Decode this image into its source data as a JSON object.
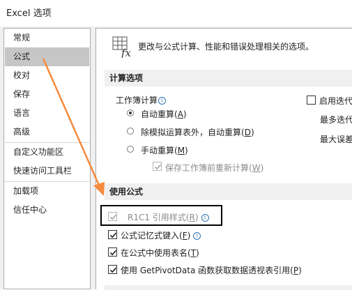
{
  "window": {
    "title": "Excel 选项"
  },
  "sidebar": {
    "items": [
      {
        "label": "常规"
      },
      {
        "label": "公式"
      },
      {
        "label": "校对"
      },
      {
        "label": "保存"
      },
      {
        "label": "语言"
      },
      {
        "label": "高级"
      },
      {
        "label": "自定义功能区"
      },
      {
        "label": "快速访问工具栏"
      },
      {
        "label": "加载项"
      },
      {
        "label": "信任中心"
      }
    ],
    "selected": "公式"
  },
  "header": {
    "text": "更改与公式计算、性能和错误处理相关的选项。",
    "icon": "formula-fx-icon"
  },
  "calc_section": {
    "title": "计算选项",
    "workbook_label": "工作簿计算",
    "radios": [
      {
        "label": "自动重算(",
        "key": "A",
        "tail": ")",
        "checked": true
      },
      {
        "label": "除模拟运算表外，自动重算(",
        "key": "D",
        "tail": ")",
        "checked": false
      },
      {
        "label": "手动重算(",
        "key": "M",
        "tail": ")",
        "checked": false
      }
    ],
    "save_before": {
      "label": "保存工作簿前重新计算(",
      "key": "W",
      "tail": ")",
      "checked": true,
      "disabled": true
    },
    "iter_label": "启用迭代",
    "max_iter_label": "最多迭代",
    "max_change_label": "最大误差"
  },
  "formula_section": {
    "title": "使用公式",
    "options": [
      {
        "label": "R1C1 引用样式(",
        "key": "R",
        "tail": ")",
        "checked": true,
        "disabled": true
      },
      {
        "label": "公式记忆式键入(",
        "key": "F",
        "tail": ")",
        "checked": true,
        "disabled": false
      },
      {
        "label": "在公式中使用表名(",
        "key": "T",
        "tail": ")",
        "checked": true,
        "disabled": false
      },
      {
        "label": "使用 GetPivotData 函数获取数据透视表引用(",
        "key": "P",
        "tail": ")",
        "checked": true,
        "disabled": false
      }
    ]
  },
  "colors": {
    "arrow": "#f58a3c",
    "selected_bg": "#c6c6c6",
    "section_bg": "#f0f0f0"
  }
}
